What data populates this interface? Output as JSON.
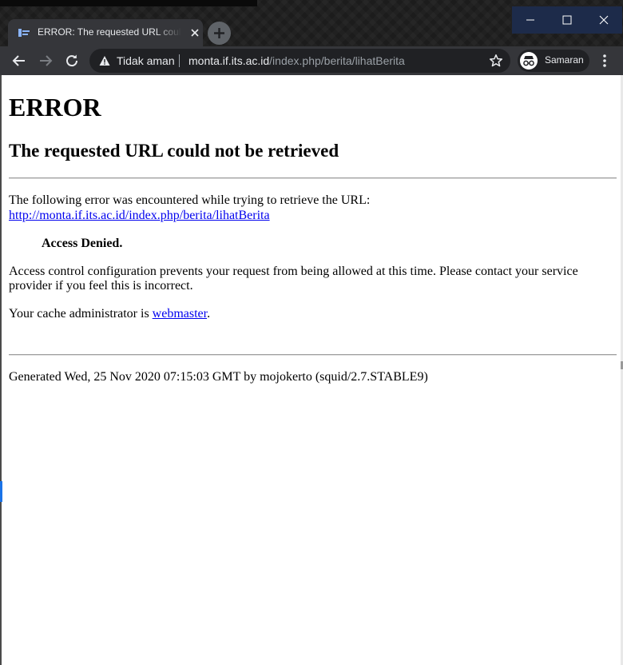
{
  "browser": {
    "tab": {
      "title": "ERROR: The requested URL could not be retrieved"
    },
    "window_controls": {
      "minimize_icon": "minimize-icon",
      "maximize_icon": "maximize-icon",
      "close_icon": "close-icon"
    },
    "omnibox": {
      "security_label": "Tidak aman",
      "url_host": "monta.if.its.ac.id",
      "url_path": "/index.php/berita/lihatBerita"
    },
    "profile": {
      "label": "Samaran"
    }
  },
  "page": {
    "heading": "ERROR",
    "subheading": "The requested URL could not be retrieved",
    "intro": "The following error was encountered while trying to retrieve the URL:",
    "url_link": "http://monta.if.its.ac.id/index.php/berita/lihatBerita",
    "error_name": "Access Denied.",
    "explanation_line1": "Access control configuration prevents your request from being allowed at this time. Please contact your service",
    "explanation_line2": "provider if you feel this is incorrect.",
    "admin_prefix": "Your cache administrator is ",
    "admin_link": "webmaster",
    "admin_suffix": ".",
    "footer": "Generated Wed, 25 Nov 2020 07:15:03 GMT by mojokerto (squid/2.7.STABLE9)"
  },
  "colors": {
    "chrome_dark": "#202124",
    "toolbar": "#35363a",
    "link": "#0000ee",
    "window_controls_bg": "#1d2b4a"
  }
}
